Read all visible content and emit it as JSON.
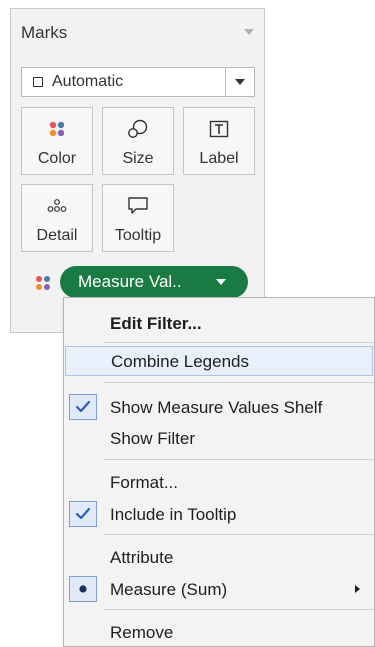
{
  "marks": {
    "title": "Marks",
    "mark_type": "Automatic",
    "buttons": [
      {
        "label": "Color",
        "icon": "color-dots-icon"
      },
      {
        "label": "Size",
        "icon": "size-icon"
      },
      {
        "label": "Label",
        "icon": "text-label-icon"
      },
      {
        "label": "Detail",
        "icon": "detail-dots-icon"
      },
      {
        "label": "Tooltip",
        "icon": "tooltip-bubble-icon"
      }
    ],
    "pill": {
      "label": "Measure Val..",
      "color": "#1a7a43"
    }
  },
  "menu": {
    "items": [
      {
        "label": "Edit Filter..."
      },
      {
        "label": "Combine Legends"
      },
      {
        "label": "Show Measure Values Shelf",
        "state": "checked"
      },
      {
        "label": "Show Filter"
      },
      {
        "label": "Format..."
      },
      {
        "label": "Include in Tooltip",
        "state": "checked"
      },
      {
        "label": "Attribute"
      },
      {
        "label": "Measure (Sum)",
        "state": "selected"
      },
      {
        "label": "Remove"
      }
    ]
  },
  "colors": {
    "accent": "#2f5fb3",
    "pill": "#1a7a43",
    "highlight": "#e8f0fb"
  }
}
